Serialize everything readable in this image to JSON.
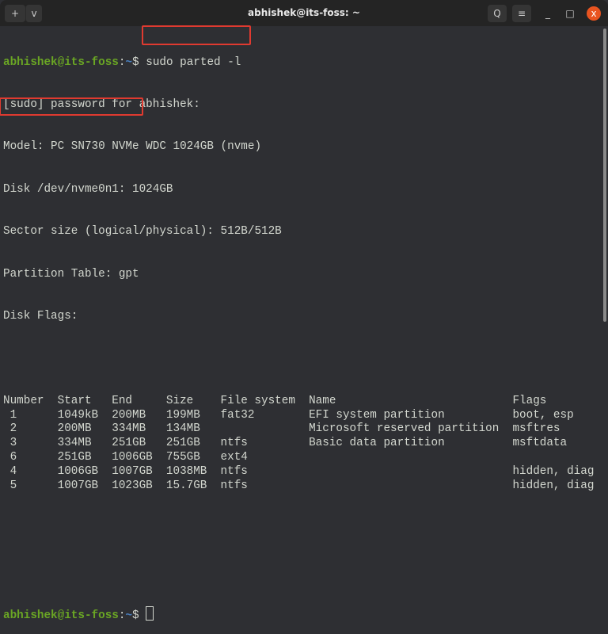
{
  "window": {
    "title": "abhishek@its-foss: ~"
  },
  "prompt": {
    "user": "abhishek@its-foss",
    "sep": ":",
    "path": "~",
    "symbol": "$"
  },
  "command": "sudo parted -l",
  "output_lines": [
    "[sudo] password for abhishek:",
    "Model: PC SN730 NVMe WDC 1024GB (nvme)",
    "Disk /dev/nvme0n1: 1024GB",
    "Sector size (logical/physical): 512B/512B",
    "Partition Table: gpt",
    "Disk Flags:"
  ],
  "table": {
    "headers": [
      "Number",
      "Start",
      "End",
      "Size",
      "File system",
      "Name",
      "Flags"
    ],
    "rows": [
      [
        " 1",
        "1049kB",
        "200MB",
        "199MB",
        "fat32",
        "EFI system partition",
        "boot, esp"
      ],
      [
        " 2",
        "200MB",
        "334MB",
        "134MB",
        "",
        "Microsoft reserved partition",
        "msftres"
      ],
      [
        " 3",
        "334MB",
        "251GB",
        "251GB",
        "ntfs",
        "Basic data partition",
        "msftdata"
      ],
      [
        " 6",
        "251GB",
        "1006GB",
        "755GB",
        "ext4",
        "",
        ""
      ],
      [
        " 4",
        "1006GB",
        "1007GB",
        "1038MB",
        "ntfs",
        "",
        "hidden, diag"
      ],
      [
        " 5",
        "1007GB",
        "1023GB",
        "15.7GB",
        "ntfs",
        "",
        "hidden, diag"
      ]
    ]
  },
  "icons": {
    "new_tab": "+",
    "menu": "v",
    "search": "Q",
    "hamburger": "≡",
    "minimize": "_",
    "maximize": "□",
    "close": "x"
  }
}
